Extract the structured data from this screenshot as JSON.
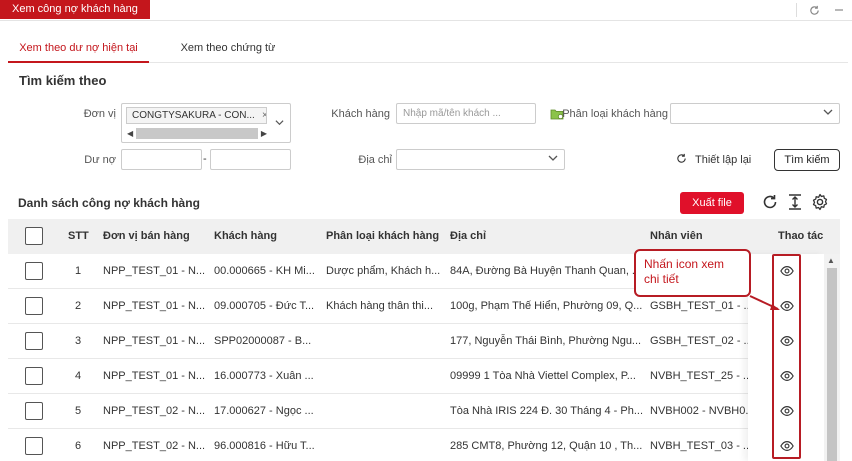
{
  "window": {
    "tab_title": "Xem công nợ khách hàng"
  },
  "tabs": [
    {
      "label": "Xem theo dư nợ hiện tại",
      "active": true
    },
    {
      "label": "Xem theo chứng từ",
      "active": false
    }
  ],
  "search": {
    "title": "Tìm kiếm theo",
    "don_vi_label": "Đơn vị",
    "don_vi_chip": "CONGTYSAKURA - CON...",
    "chip_remove": "×",
    "khach_hang_label": "Khách hàng",
    "khach_hang_placeholder": "Nhập mã/tên khách ...",
    "phan_loai_label": "Phân loại khách hàng",
    "du_no_label": "Dư nợ",
    "du_no_separator": "-",
    "dia_chi_label": "Địa chỉ",
    "reset_label": "Thiết lập lại",
    "search_button": "Tìm kiếm"
  },
  "list": {
    "title": "Danh sách công nợ khách hàng",
    "export_button": "Xuất file",
    "columns": [
      "STT",
      "Đơn vị bán hàng",
      "Khách hàng",
      "Phân loại khách hàng",
      "Địa chỉ",
      "Nhân viên",
      "Thao tác"
    ],
    "rows": [
      {
        "stt": "1",
        "don_vi": "NPP_TEST_01 - N...",
        "khach_hang": "00.000665 - KH Mi...",
        "phan_loai": "Dược phẩm, Khách h...",
        "dia_chi": "84A, Đường Bà Huyện Thanh Quan, ...",
        "nhan_vien": ""
      },
      {
        "stt": "2",
        "don_vi": "NPP_TEST_01 - N...",
        "khach_hang": "09.000705 - Đức T...",
        "phan_loai": "Khách hàng thân thi...",
        "dia_chi": "100g, Phạm Thế Hiển, Phường 09, Q...",
        "nhan_vien": "GSBH_TEST_01 - ..."
      },
      {
        "stt": "3",
        "don_vi": "NPP_TEST_01 - N...",
        "khach_hang": "SPP02000087 - B...",
        "phan_loai": "",
        "dia_chi": "177, Nguyễn Thái Bình, Phường Ngu...",
        "nhan_vien": "GSBH_TEST_02 - ..."
      },
      {
        "stt": "4",
        "don_vi": "NPP_TEST_01 - N...",
        "khach_hang": "16.000773 - Xuân ...",
        "phan_loai": "",
        "dia_chi": "09999 1 Tòa Nhà Viettel Complex, P...",
        "nhan_vien": "NVBH_TEST_25 - ..."
      },
      {
        "stt": "5",
        "don_vi": "NPP_TEST_02 - N...",
        "khach_hang": "17.000627 - Ngọc ...",
        "phan_loai": "",
        "dia_chi": "Tòa Nhà IRIS 224 Đ. 30 Tháng 4 - Ph...",
        "nhan_vien": "NVBH002 - NVBH0..."
      },
      {
        "stt": "6",
        "don_vi": "NPP_TEST_02 - N...",
        "khach_hang": "96.000816 - Hữu T...",
        "phan_loai": "",
        "dia_chi": "285 CMT8, Phường 12, Quận 10 , Th...",
        "nhan_vien": "NVBH_TEST_03 - ..."
      }
    ]
  },
  "annotation": {
    "callout_text": "Nhấn icon xem chi tiết"
  },
  "colors": {
    "brand_red": "#c4161c",
    "button_red": "#e0102a",
    "header_bg": "#f0f0f0"
  },
  "icons": [
    "refresh-icon",
    "minimize-icon",
    "folder-icon",
    "chevron-down-icon",
    "reload-icon",
    "column-height-icon",
    "settings-icon",
    "eye-icon"
  ]
}
